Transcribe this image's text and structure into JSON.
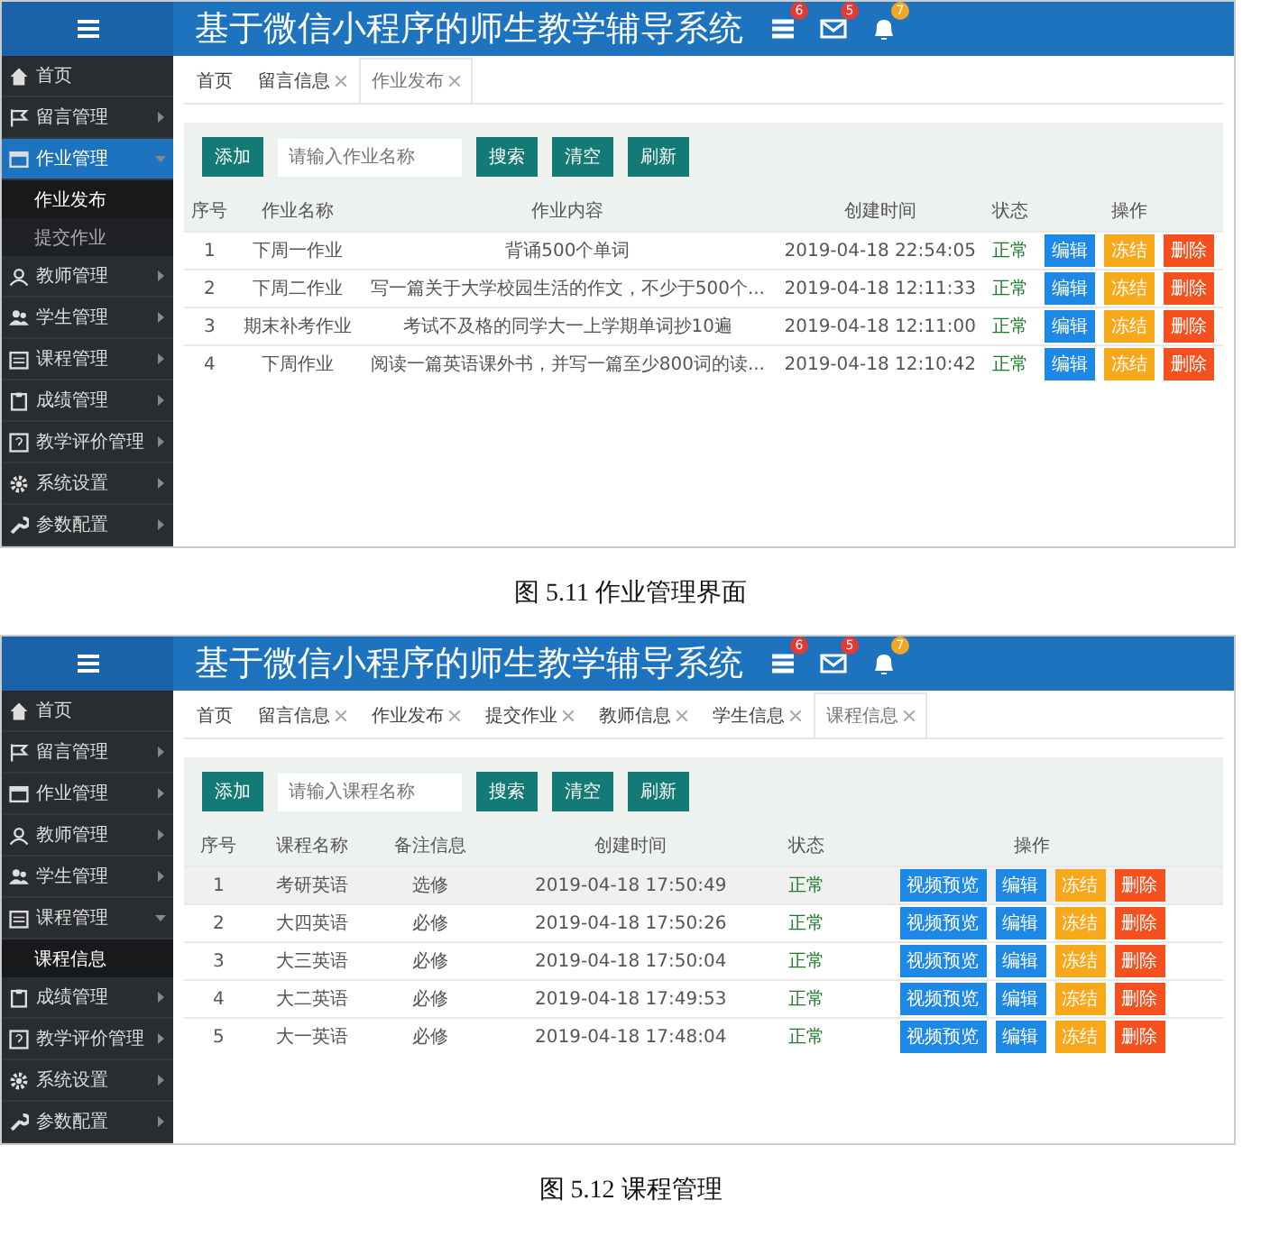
{
  "figures": [
    {
      "app": {
        "title": "基于微信小程序的师生教学辅导系统",
        "badges": [
          {
            "count": "6",
            "color": "#e53935"
          },
          {
            "count": "5",
            "color": "#e53935"
          },
          {
            "count": "7",
            "color": "#f5a623"
          }
        ],
        "sidebar": [
          {
            "label": "首页",
            "selected": false
          },
          {
            "label": "留言管理",
            "selected": false,
            "expanded": false
          },
          {
            "label": "作业管理",
            "selected": true,
            "expanded": true,
            "children": [
              {
                "label": "作业发布",
                "selected": true
              },
              {
                "label": "提交作业",
                "selected": false
              }
            ]
          },
          {
            "label": "教师管理",
            "selected": false,
            "expanded": false
          },
          {
            "label": "学生管理",
            "selected": false,
            "expanded": false
          },
          {
            "label": "课程管理",
            "selected": false,
            "expanded": false
          },
          {
            "label": "成绩管理",
            "selected": false,
            "expanded": false
          },
          {
            "label": "教学评价管理",
            "selected": false,
            "expanded": false
          },
          {
            "label": "系统设置",
            "selected": false,
            "expanded": false
          },
          {
            "label": "参数配置",
            "selected": false,
            "expanded": false
          }
        ],
        "tabs": [
          {
            "label": "首页",
            "closable": false,
            "selected": false
          },
          {
            "label": "留言信息",
            "closable": true,
            "selected": false
          },
          {
            "label": "作业发布",
            "closable": true,
            "selected": true
          }
        ],
        "toolbar": {
          "add_button": "添加",
          "placeholder": "请输入作业名称",
          "buttons": [
            "搜索",
            "清空",
            "刷新"
          ]
        },
        "table": {
          "columns": [
            "序号",
            "作业名称",
            "作业内容",
            "创建时间",
            "状态",
            "操作"
          ],
          "rows": [
            {
              "cells": [
                "1",
                "下周一作业",
                "背诵500个单词",
                "2019-04-18 22:54:05"
              ],
              "status": "正常",
              "selected": false,
              "actions": [
                {
                  "label": "编辑",
                  "color": "#1e88e5"
                },
                {
                  "label": "冻结",
                  "color": "#f7a81b"
                },
                {
                  "label": "删除",
                  "color": "#f4511e"
                }
              ]
            },
            {
              "cells": [
                "2",
                "下周二作业",
                "写一篇关于大学校园生活的作文，不少于500个...",
                "2019-04-18 12:11:33"
              ],
              "status": "正常",
              "selected": false,
              "actions": [
                {
                  "label": "编辑",
                  "color": "#1e88e5"
                },
                {
                  "label": "冻结",
                  "color": "#f7a81b"
                },
                {
                  "label": "删除",
                  "color": "#f4511e"
                }
              ]
            },
            {
              "cells": [
                "3",
                "期末补考作业",
                "考试不及格的同学大一上学期单词抄10遍",
                "2019-04-18 12:11:00"
              ],
              "status": "正常",
              "selected": false,
              "actions": [
                {
                  "label": "编辑",
                  "color": "#1e88e5"
                },
                {
                  "label": "冻结",
                  "color": "#f7a81b"
                },
                {
                  "label": "删除",
                  "color": "#f4511e"
                }
              ]
            },
            {
              "cells": [
                "4",
                "下周作业",
                "阅读一篇英语课外书，并写一篇至少800词的读...",
                "2019-04-18 12:10:42"
              ],
              "status": "正常",
              "selected": false,
              "actions": [
                {
                  "label": "编辑",
                  "color": "#1e88e5"
                },
                {
                  "label": "冻结",
                  "color": "#f7a81b"
                },
                {
                  "label": "删除",
                  "color": "#f4511e"
                }
              ]
            }
          ]
        }
      },
      "caption": "图 5.11 作业管理界面"
    },
    {
      "app": {
        "title": "基于微信小程序的师生教学辅导系统",
        "badges": [
          {
            "count": "6",
            "color": "#e53935"
          },
          {
            "count": "5",
            "color": "#e53935"
          },
          {
            "count": "7",
            "color": "#f5a623"
          }
        ],
        "sidebar": [
          {
            "label": "首页",
            "selected": false
          },
          {
            "label": "留言管理",
            "selected": false,
            "expanded": false
          },
          {
            "label": "作业管理",
            "selected": false,
            "expanded": false
          },
          {
            "label": "教师管理",
            "selected": false,
            "expanded": false
          },
          {
            "label": "学生管理",
            "selected": false,
            "expanded": false
          },
          {
            "label": "课程管理",
            "selected": false,
            "expanded": true,
            "children": [
              {
                "label": "课程信息",
                "selected": true
              }
            ]
          },
          {
            "label": "成绩管理",
            "selected": false,
            "expanded": false
          },
          {
            "label": "教学评价管理",
            "selected": false,
            "expanded": false
          },
          {
            "label": "系统设置",
            "selected": false,
            "expanded": false
          },
          {
            "label": "参数配置",
            "selected": false,
            "expanded": false
          }
        ],
        "tabs": [
          {
            "label": "首页",
            "closable": false,
            "selected": false
          },
          {
            "label": "留言信息",
            "closable": true,
            "selected": false
          },
          {
            "label": "作业发布",
            "closable": true,
            "selected": false
          },
          {
            "label": "提交作业",
            "closable": true,
            "selected": false
          },
          {
            "label": "教师信息",
            "closable": true,
            "selected": false
          },
          {
            "label": "学生信息",
            "closable": true,
            "selected": false
          },
          {
            "label": "课程信息",
            "closable": true,
            "selected": true
          }
        ],
        "toolbar": {
          "add_button": "添加",
          "placeholder": "请输入课程名称",
          "buttons": [
            "搜索",
            "清空",
            "刷新"
          ]
        },
        "table": {
          "columns": [
            "序号",
            "课程名称",
            "备注信息",
            "创建时间",
            "状态",
            "操作"
          ],
          "rows": [
            {
              "cells": [
                "1",
                "考研英语",
                "选修",
                "2019-04-18 17:50:49"
              ],
              "status": "正常",
              "selected": true,
              "actions": [
                {
                  "label": "视频预览",
                  "color": "#1e88e5"
                },
                {
                  "label": "编辑",
                  "color": "#1e88e5"
                },
                {
                  "label": "冻结",
                  "color": "#f7a81b"
                },
                {
                  "label": "删除",
                  "color": "#f4511e"
                }
              ]
            },
            {
              "cells": [
                "2",
                "大四英语",
                "必修",
                "2019-04-18 17:50:26"
              ],
              "status": "正常",
              "selected": false,
              "actions": [
                {
                  "label": "视频预览",
                  "color": "#1e88e5"
                },
                {
                  "label": "编辑",
                  "color": "#1e88e5"
                },
                {
                  "label": "冻结",
                  "color": "#f7a81b"
                },
                {
                  "label": "删除",
                  "color": "#f4511e"
                }
              ]
            },
            {
              "cells": [
                "3",
                "大三英语",
                "必修",
                "2019-04-18 17:50:04"
              ],
              "status": "正常",
              "selected": false,
              "actions": [
                {
                  "label": "视频预览",
                  "color": "#1e88e5"
                },
                {
                  "label": "编辑",
                  "color": "#1e88e5"
                },
                {
                  "label": "冻结",
                  "color": "#f7a81b"
                },
                {
                  "label": "删除",
                  "color": "#f4511e"
                }
              ]
            },
            {
              "cells": [
                "4",
                "大二英语",
                "必修",
                "2019-04-18 17:49:53"
              ],
              "status": "正常",
              "selected": false,
              "actions": [
                {
                  "label": "视频预览",
                  "color": "#1e88e5"
                },
                {
                  "label": "编辑",
                  "color": "#1e88e5"
                },
                {
                  "label": "冻结",
                  "color": "#f7a81b"
                },
                {
                  "label": "删除",
                  "color": "#f4511e"
                }
              ]
            },
            {
              "cells": [
                "5",
                "大一英语",
                "必修",
                "2019-04-18 17:48:04"
              ],
              "status": "正常",
              "selected": false,
              "actions": [
                {
                  "label": "视频预览",
                  "color": "#1e88e5"
                },
                {
                  "label": "编辑",
                  "color": "#1e88e5"
                },
                {
                  "label": "冻结",
                  "color": "#f7a81b"
                },
                {
                  "label": "删除",
                  "color": "#f4511e"
                }
              ]
            }
          ]
        }
      },
      "caption": "图 5.12 课程管理"
    }
  ]
}
